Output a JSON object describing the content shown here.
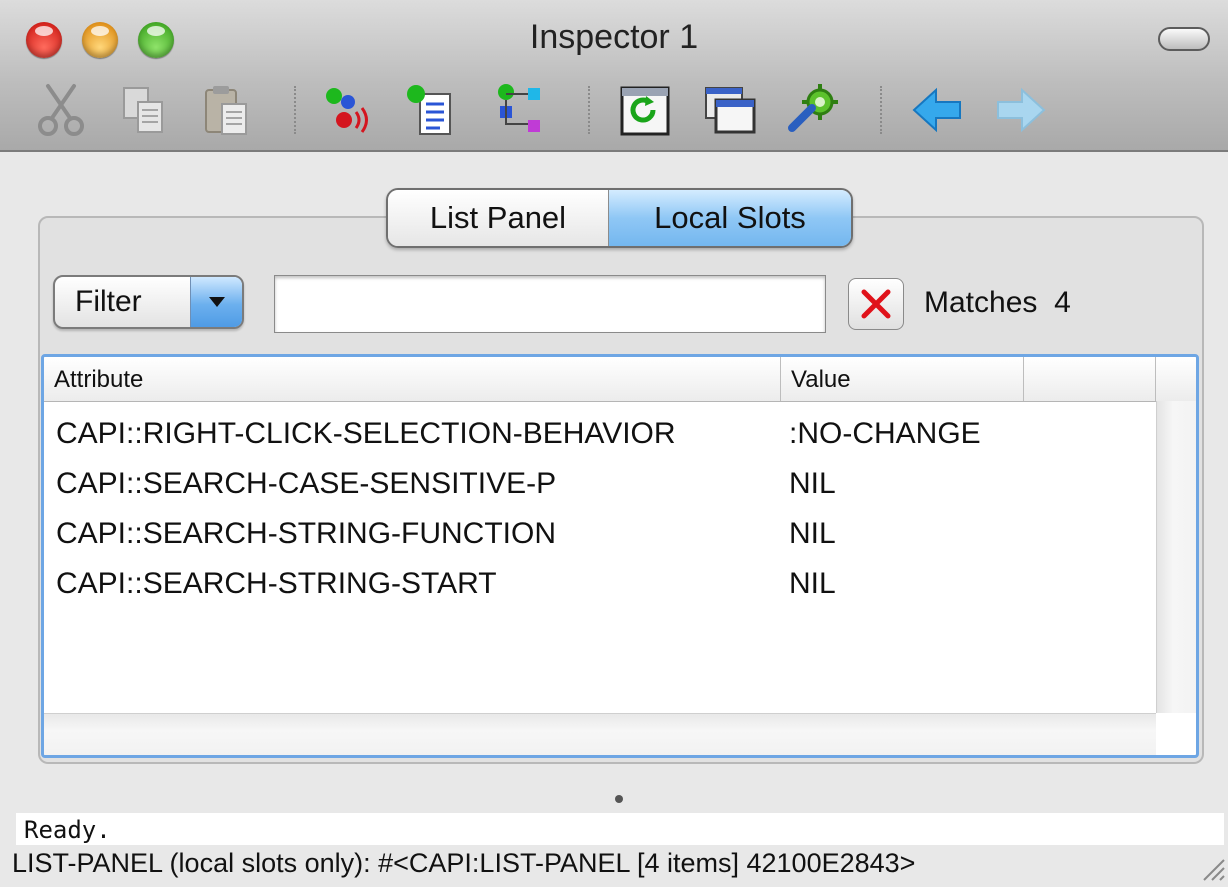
{
  "window": {
    "title": "Inspector 1",
    "traffic_lights": [
      "close",
      "minimize",
      "zoom"
    ]
  },
  "toolbar": {
    "buttons": [
      {
        "name": "cut-icon",
        "enabled": false
      },
      {
        "name": "copy-icon",
        "enabled": false
      },
      {
        "name": "paste-icon",
        "enabled": false
      },
      {
        "name": "object-references-icon",
        "enabled": true
      },
      {
        "name": "browse-object-icon",
        "enabled": true
      },
      {
        "name": "class-graph-icon",
        "enabled": true
      },
      {
        "name": "refresh-icon",
        "enabled": true
      },
      {
        "name": "new-window-icon",
        "enabled": true
      },
      {
        "name": "preferences-icon",
        "enabled": true
      },
      {
        "name": "back-arrow-icon",
        "enabled": true
      },
      {
        "name": "forward-arrow-icon",
        "enabled": false
      }
    ]
  },
  "tabs": [
    {
      "label": "List Panel",
      "selected": false
    },
    {
      "label": "Local Slots",
      "selected": true
    }
  ],
  "filter": {
    "label": "Filter",
    "search_value": "",
    "matches_label": "Matches",
    "matches_count": "4"
  },
  "table": {
    "columns": [
      "Attribute",
      "Value"
    ],
    "rows": [
      {
        "attribute": "CAPI::RIGHT-CLICK-SELECTION-BEHAVIOR",
        "value": ":NO-CHANGE"
      },
      {
        "attribute": "CAPI::SEARCH-CASE-SENSITIVE-P",
        "value": "NIL"
      },
      {
        "attribute": "CAPI::SEARCH-STRING-FUNCTION",
        "value": "NIL"
      },
      {
        "attribute": "CAPI::SEARCH-STRING-START",
        "value": "NIL"
      }
    ]
  },
  "status": {
    "message": "Ready.",
    "description": "LIST-PANEL (local slots only): #<CAPI:LIST-PANEL [4 items] 42100E2843>"
  },
  "colors": {
    "selected_tab": "#8fc7f5",
    "table_focus_border": "#6ea6e4",
    "clear_x": "#e0121a"
  }
}
